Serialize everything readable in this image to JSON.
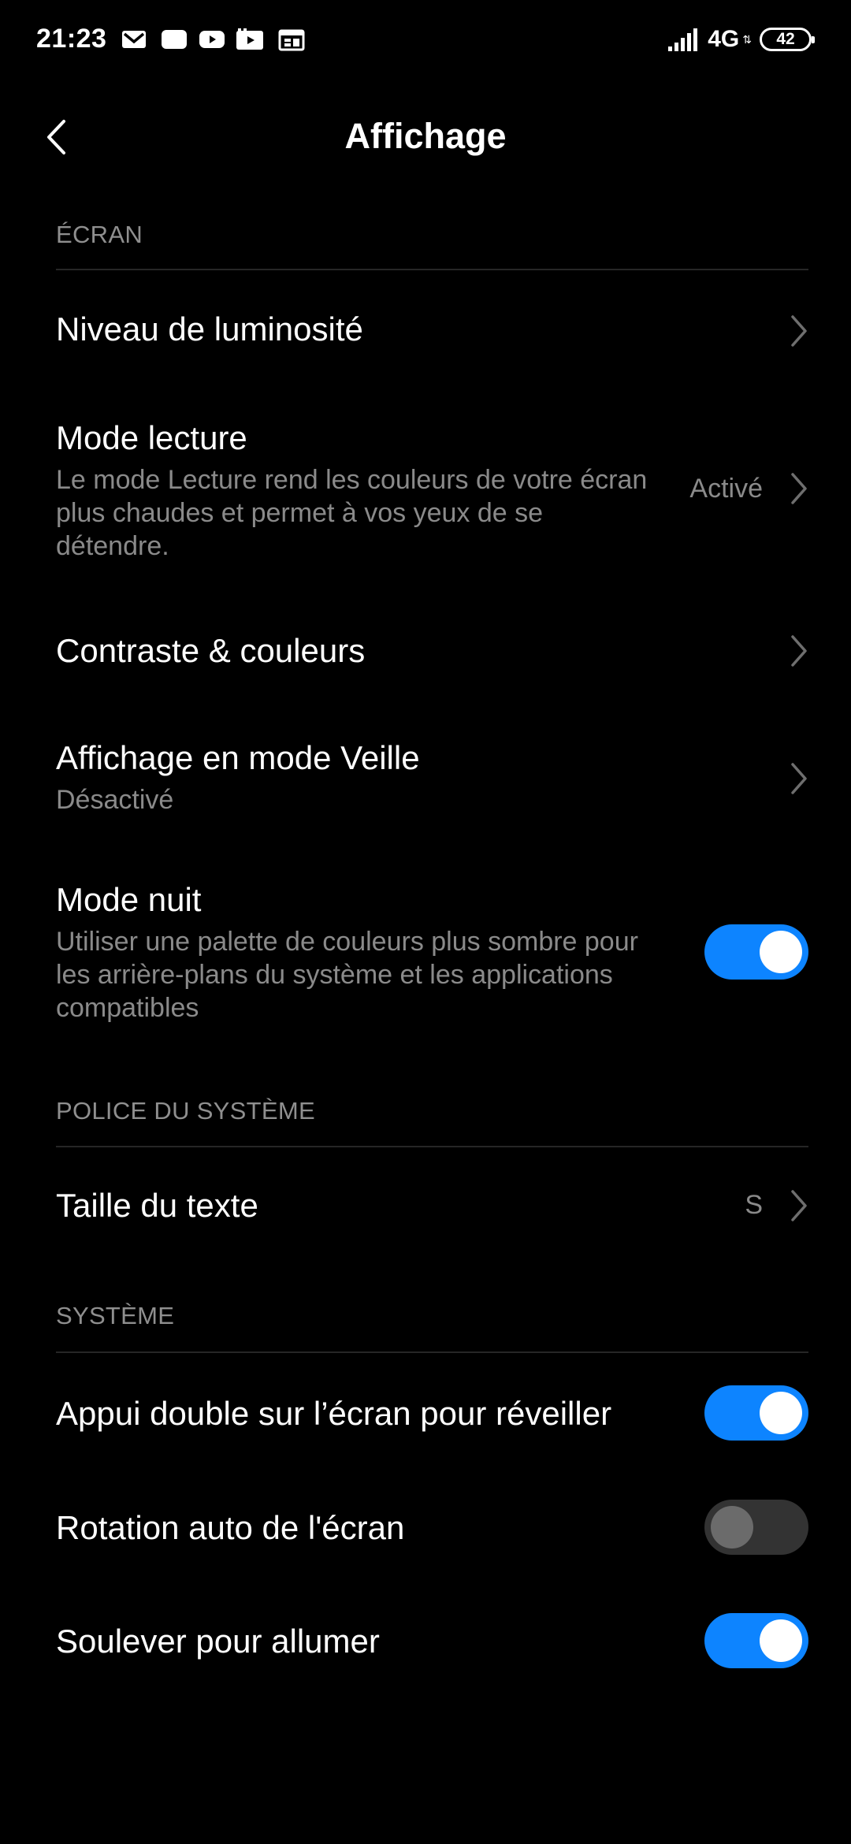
{
  "status_bar": {
    "time": "21:23",
    "notifications": [
      "gmail-icon",
      "message-icon",
      "youtube-icon",
      "video-icon",
      "calendar-icon"
    ],
    "network": "4G",
    "battery": "42"
  },
  "header": {
    "back_icon": "chevron-left-icon",
    "title": "Affichage"
  },
  "sections": {
    "ecran": {
      "header": "ÉCRAN",
      "brightness": {
        "title": "Niveau de luminosité"
      },
      "reading_mode": {
        "title": "Mode lecture",
        "description": "Le mode Lecture rend les couleurs de votre écran plus chaudes et permet à vos yeux de se détendre.",
        "value": "Activé"
      },
      "contrast": {
        "title": "Contraste & couleurs"
      },
      "ambient_display": {
        "title": "Affichage en mode Veille",
        "subtitle": "Désactivé"
      },
      "night_mode": {
        "title": "Mode nuit",
        "description": "Utiliser une palette de couleurs plus sombre pour les arrière-plans du système et les applications compatibles",
        "enabled": true
      }
    },
    "police": {
      "header": "POLICE DU SYSTÈME",
      "text_size": {
        "title": "Taille du texte",
        "value": "S"
      }
    },
    "systeme": {
      "header": "SYSTÈME",
      "double_tap": {
        "title": "Appui double sur l’écran pour réveiller",
        "enabled": true
      },
      "auto_rotate": {
        "title": "Rotation auto de l'écran",
        "enabled": false
      },
      "lift_to_wake": {
        "title": "Soulever pour allumer",
        "enabled": true
      }
    }
  },
  "colors": {
    "background": "#000000",
    "accent": "#0d84ff",
    "secondary_text": "#8a8a8a"
  }
}
